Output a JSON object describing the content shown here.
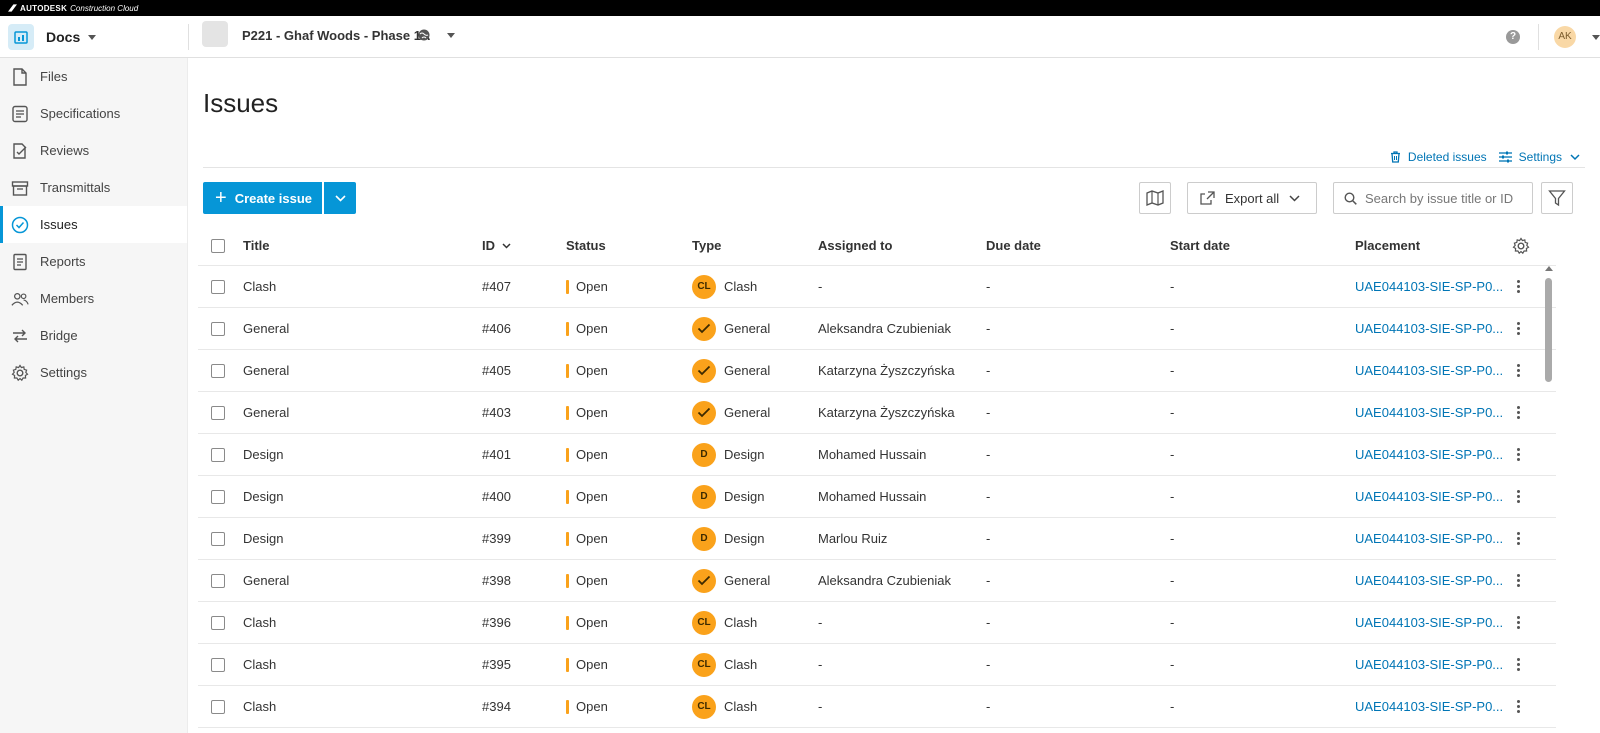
{
  "brand": {
    "name": "AUTODESK",
    "product": "Construction Cloud"
  },
  "header": {
    "module": "Docs",
    "project": "P221 - Ghaf Woods - Phase 1A",
    "help": "?",
    "avatar_initials": "AK"
  },
  "sidebar": {
    "items": [
      {
        "label": "Files",
        "icon": "file-icon",
        "active": false
      },
      {
        "label": "Specifications",
        "icon": "specifications-icon",
        "active": false
      },
      {
        "label": "Reviews",
        "icon": "reviews-icon",
        "active": false
      },
      {
        "label": "Transmittals",
        "icon": "transmittals-icon",
        "active": false
      },
      {
        "label": "Issues",
        "icon": "issues-icon",
        "active": true
      },
      {
        "label": "Reports",
        "icon": "reports-icon",
        "active": false
      },
      {
        "label": "Members",
        "icon": "members-icon",
        "active": false
      },
      {
        "label": "Bridge",
        "icon": "bridge-icon",
        "active": false
      },
      {
        "label": "Settings",
        "icon": "gear-icon",
        "active": false
      }
    ]
  },
  "main": {
    "title": "Issues",
    "links": {
      "deleted": "Deleted issues",
      "settings": "Settings"
    },
    "toolbar": {
      "create": "Create issue",
      "export": "Export all",
      "search_placeholder": "Search by issue title or ID"
    },
    "table": {
      "headers": {
        "title": "Title",
        "id": "ID",
        "status": "Status",
        "type": "Type",
        "assigned": "Assigned to",
        "due": "Due date",
        "start": "Start date",
        "placement": "Placement"
      },
      "rows": [
        {
          "title": "Clash",
          "id": "#407",
          "status": "Open",
          "type": "Clash",
          "badge": "CL",
          "assigned": "-",
          "due": "-",
          "start": "-",
          "placement": "UAE044103-SIE-SP-P0..."
        },
        {
          "title": "General",
          "id": "#406",
          "status": "Open",
          "type": "General",
          "badge": "check",
          "assigned": "Aleksandra Czubieniak",
          "due": "-",
          "start": "-",
          "placement": "UAE044103-SIE-SP-P0..."
        },
        {
          "title": "General",
          "id": "#405",
          "status": "Open",
          "type": "General",
          "badge": "check",
          "assigned": "Katarzyna Żyszczyńska",
          "due": "-",
          "start": "-",
          "placement": "UAE044103-SIE-SP-P0..."
        },
        {
          "title": "General",
          "id": "#403",
          "status": "Open",
          "type": "General",
          "badge": "check",
          "assigned": "Katarzyna Żyszczyńska",
          "due": "-",
          "start": "-",
          "placement": "UAE044103-SIE-SP-P0..."
        },
        {
          "title": "Design",
          "id": "#401",
          "status": "Open",
          "type": "Design",
          "badge": "D",
          "assigned": "Mohamed Hussain",
          "due": "-",
          "start": "-",
          "placement": "UAE044103-SIE-SP-P0..."
        },
        {
          "title": "Design",
          "id": "#400",
          "status": "Open",
          "type": "Design",
          "badge": "D",
          "assigned": "Mohamed Hussain",
          "due": "-",
          "start": "-",
          "placement": "UAE044103-SIE-SP-P0..."
        },
        {
          "title": "Design",
          "id": "#399",
          "status": "Open",
          "type": "Design",
          "badge": "D",
          "assigned": "Marlou Ruiz",
          "due": "-",
          "start": "-",
          "placement": "UAE044103-SIE-SP-P0..."
        },
        {
          "title": "General",
          "id": "#398",
          "status": "Open",
          "type": "General",
          "badge": "check",
          "assigned": "Aleksandra Czubieniak",
          "due": "-",
          "start": "-",
          "placement": "UAE044103-SIE-SP-P0..."
        },
        {
          "title": "Clash",
          "id": "#396",
          "status": "Open",
          "type": "Clash",
          "badge": "CL",
          "assigned": "-",
          "due": "-",
          "start": "-",
          "placement": "UAE044103-SIE-SP-P0..."
        },
        {
          "title": "Clash",
          "id": "#395",
          "status": "Open",
          "type": "Clash",
          "badge": "CL",
          "assigned": "-",
          "due": "-",
          "start": "-",
          "placement": "UAE044103-SIE-SP-P0..."
        },
        {
          "title": "Clash",
          "id": "#394",
          "status": "Open",
          "type": "Clash",
          "badge": "CL",
          "assigned": "-",
          "due": "-",
          "start": "-",
          "placement": "UAE044103-SIE-SP-P0..."
        }
      ]
    }
  },
  "colors": {
    "accent": "#0696d7",
    "status_open": "#faa21b",
    "link": "#0075b5"
  }
}
